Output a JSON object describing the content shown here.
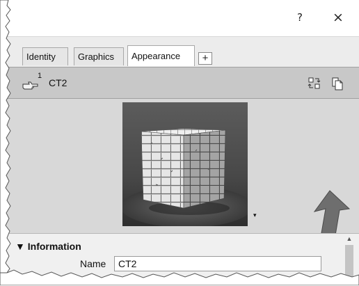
{
  "window": {
    "help_label": "?",
    "close_label": "×"
  },
  "tabs": [
    {
      "label": "Identity",
      "active": false
    },
    {
      "label": "Graphics",
      "active": false
    },
    {
      "label": "Appearance",
      "active": true
    }
  ],
  "add_tab_label": "+",
  "object": {
    "index": "1",
    "name": "CT2"
  },
  "icons": {
    "object": "hand-pointer-icon",
    "tool_1": "swap-icon",
    "tool_2": "copy-pages-icon",
    "thumbnail_menu": "dropdown-triangle-icon",
    "collapse": "collapse-triangle-icon"
  },
  "thumbnail_menu_glyph": "▾",
  "info": {
    "header": "▼ Information",
    "name_label": "Name",
    "name_value": "CT2"
  },
  "scrollbar": {
    "up_glyph": "▲"
  },
  "colors": {
    "arrow": "#6e6e6e",
    "object_bar": "#c8c8c8",
    "content_bg": "#d8d8d8"
  }
}
